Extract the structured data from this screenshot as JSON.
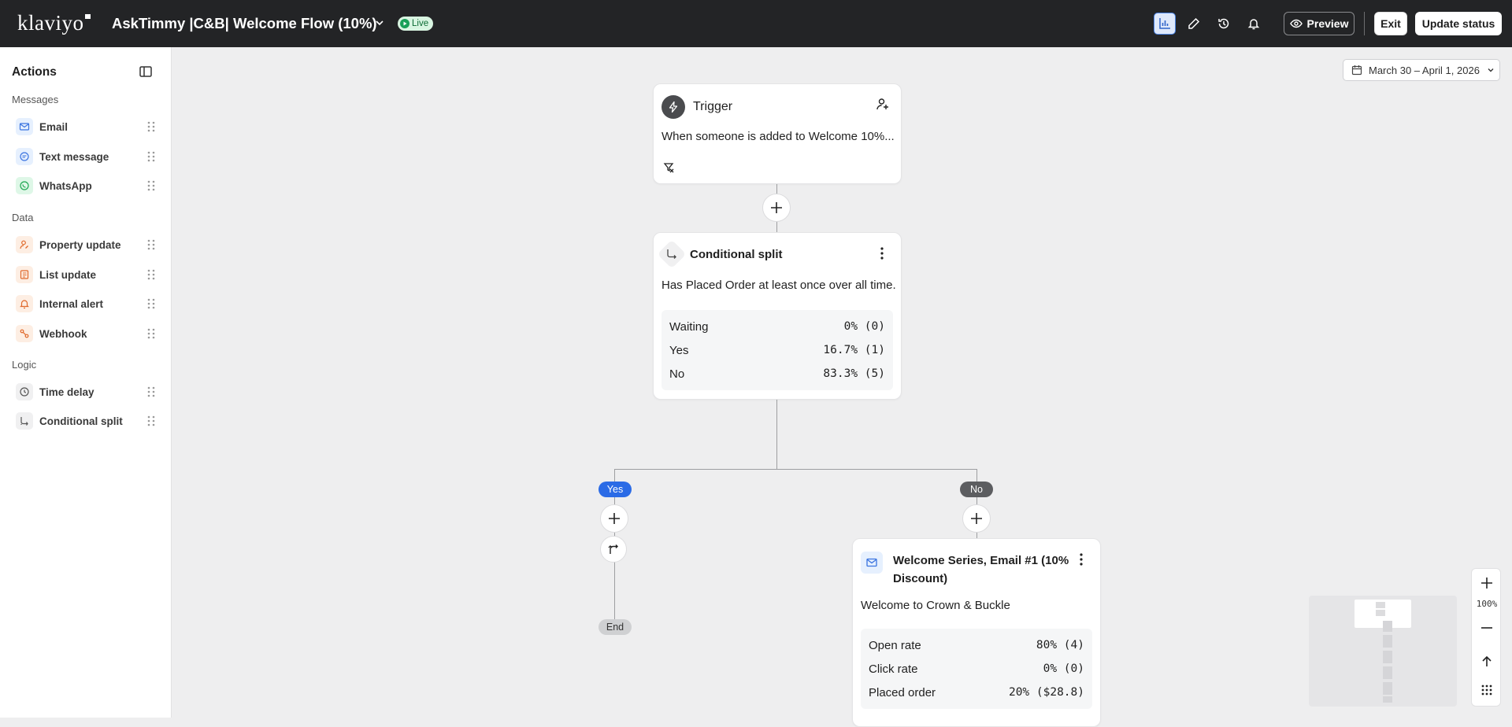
{
  "header": {
    "logo": "klaviyo",
    "flow_title": "AskTimmy |C&B| Welcome Flow (10%)",
    "status_badge": "Live",
    "preview_label": "Preview",
    "exit_label": "Exit",
    "update_status_label": "Update status",
    "toolbar_icons": [
      "analytics-icon",
      "edit-icon",
      "history-icon",
      "bell-icon"
    ]
  },
  "sidebar": {
    "title": "Actions",
    "sections": [
      {
        "label": "Messages",
        "items": [
          {
            "label": "Email",
            "icon": "mail-icon",
            "color": "#3b74e0"
          },
          {
            "label": "Text message",
            "icon": "sms-icon",
            "color": "#3b74e0"
          },
          {
            "label": "WhatsApp",
            "icon": "whatsapp-icon",
            "color": "#1da851"
          }
        ]
      },
      {
        "label": "Data",
        "items": [
          {
            "label": "Property update",
            "icon": "person-edit-icon",
            "color": "#e0692b"
          },
          {
            "label": "List update",
            "icon": "list-icon",
            "color": "#e0692b"
          },
          {
            "label": "Internal alert",
            "icon": "bell-icon",
            "color": "#e0692b"
          },
          {
            "label": "Webhook",
            "icon": "webhook-icon",
            "color": "#e0692b"
          }
        ]
      },
      {
        "label": "Logic",
        "items": [
          {
            "label": "Time delay",
            "icon": "clock-icon",
            "color": "#555"
          },
          {
            "label": "Conditional split",
            "icon": "split-icon",
            "color": "#555"
          }
        ]
      }
    ]
  },
  "canvas": {
    "date_range": "March 30 – April 1, 2026",
    "trigger": {
      "title": "Trigger",
      "description": "When someone is added to Welcome 10%..."
    },
    "split": {
      "title": "Conditional split",
      "description": "Has Placed Order at least once over all time.",
      "stats": [
        {
          "label": "Waiting",
          "value": "0% (0)"
        },
        {
          "label": "Yes",
          "value": "16.7% (1)"
        },
        {
          "label": "No",
          "value": "83.3% (5)"
        }
      ]
    },
    "branch_yes_label": "Yes",
    "branch_no_label": "No",
    "end_label": "End",
    "email": {
      "title_line1": "Welcome Series, Email #1 (10%",
      "title_line2": "Discount)",
      "subject": "Welcome to Crown & Buckle",
      "stats": [
        {
          "label": "Open rate",
          "value": "80% (4)"
        },
        {
          "label": "Click rate",
          "value": "0% (0)"
        },
        {
          "label": "Placed order",
          "value": "20% ($28.8)"
        }
      ]
    },
    "zoom_level": "100%"
  }
}
